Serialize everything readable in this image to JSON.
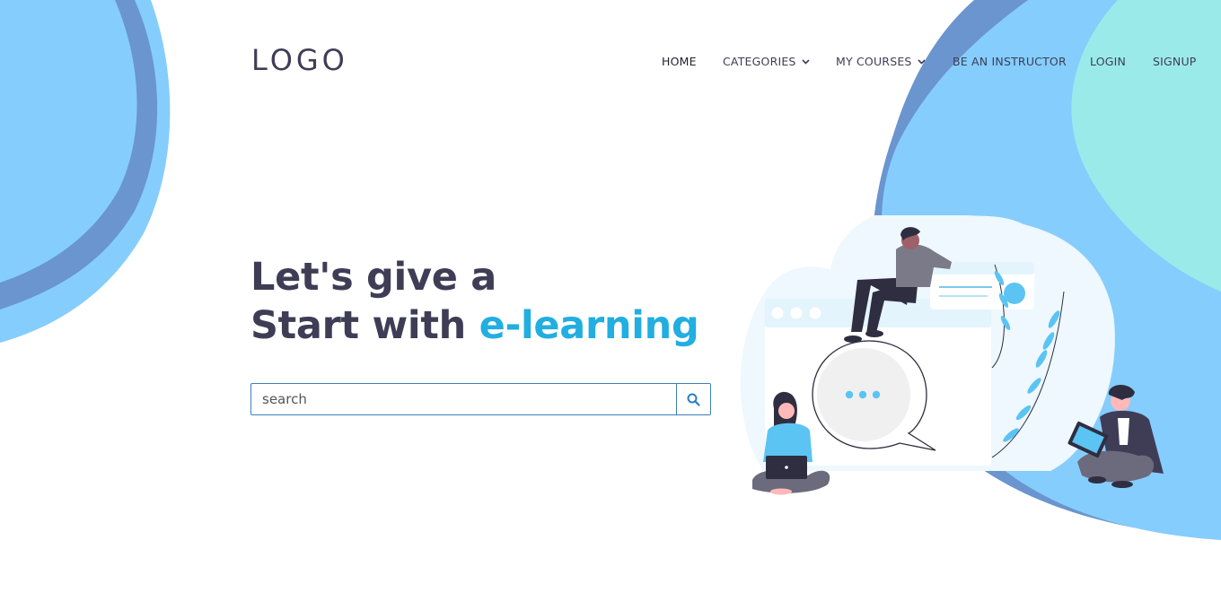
{
  "header": {
    "logo": "LOGO",
    "nav": [
      {
        "label": "HOME"
      },
      {
        "label": "CATEGORIES"
      },
      {
        "label": "MY COURSES"
      },
      {
        "label": "BE AN INSTRUCTOR"
      },
      {
        "label": "LOGIN"
      },
      {
        "label": "SIGNUP"
      }
    ]
  },
  "hero": {
    "line1": "Let's give a",
    "line2_prefix": "Start with ",
    "line2_accent": "e-learning",
    "search": {
      "placeholder": "search",
      "value": "",
      "icon": "search-icon"
    }
  },
  "colors": {
    "text_dark": "#3f3d56",
    "accent": "#22aee0",
    "blob_light_blue": "#85cdfd",
    "blob_dark_blue": "#6a95cf",
    "blob_teal": "#9beaea"
  }
}
